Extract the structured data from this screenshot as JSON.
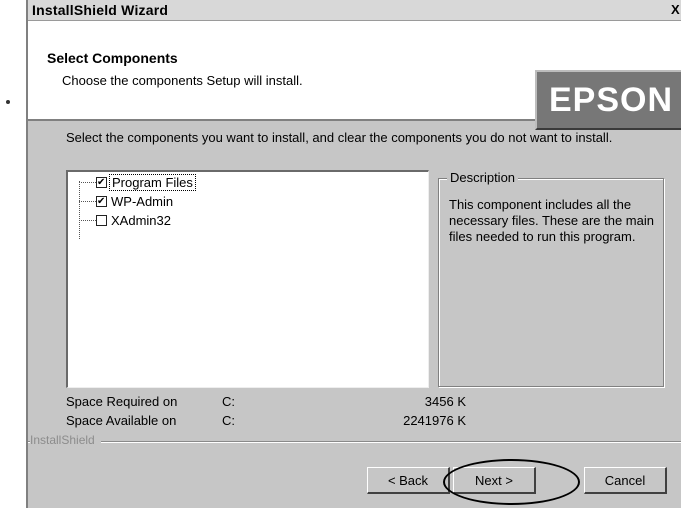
{
  "window": {
    "title": "InstallShield Wizard",
    "close_label": "X"
  },
  "header": {
    "title": "Select Components",
    "subtitle": "Choose the components Setup will install.",
    "logo_text": "EPSON"
  },
  "instruction": "Select the components you want to install, and clear the components you do not want to install.",
  "components": [
    {
      "label": "Program Files",
      "checked": true,
      "selected": true
    },
    {
      "label": "WP-Admin",
      "checked": true,
      "selected": false
    },
    {
      "label": "XAdmin32",
      "checked": false,
      "selected": false
    }
  ],
  "description": {
    "legend": "Description",
    "text": "This component includes all the necessary files.  These are the main files needed to run this program."
  },
  "space": {
    "required_label": "Space Required on",
    "required_drive": "C:",
    "required_value": "3456 K",
    "available_label": "Space Available on",
    "available_drive": "C:",
    "available_value": "2241976 K"
  },
  "brand": "InstallShield",
  "buttons": {
    "back": "< Back",
    "next": "Next >",
    "cancel": "Cancel"
  }
}
